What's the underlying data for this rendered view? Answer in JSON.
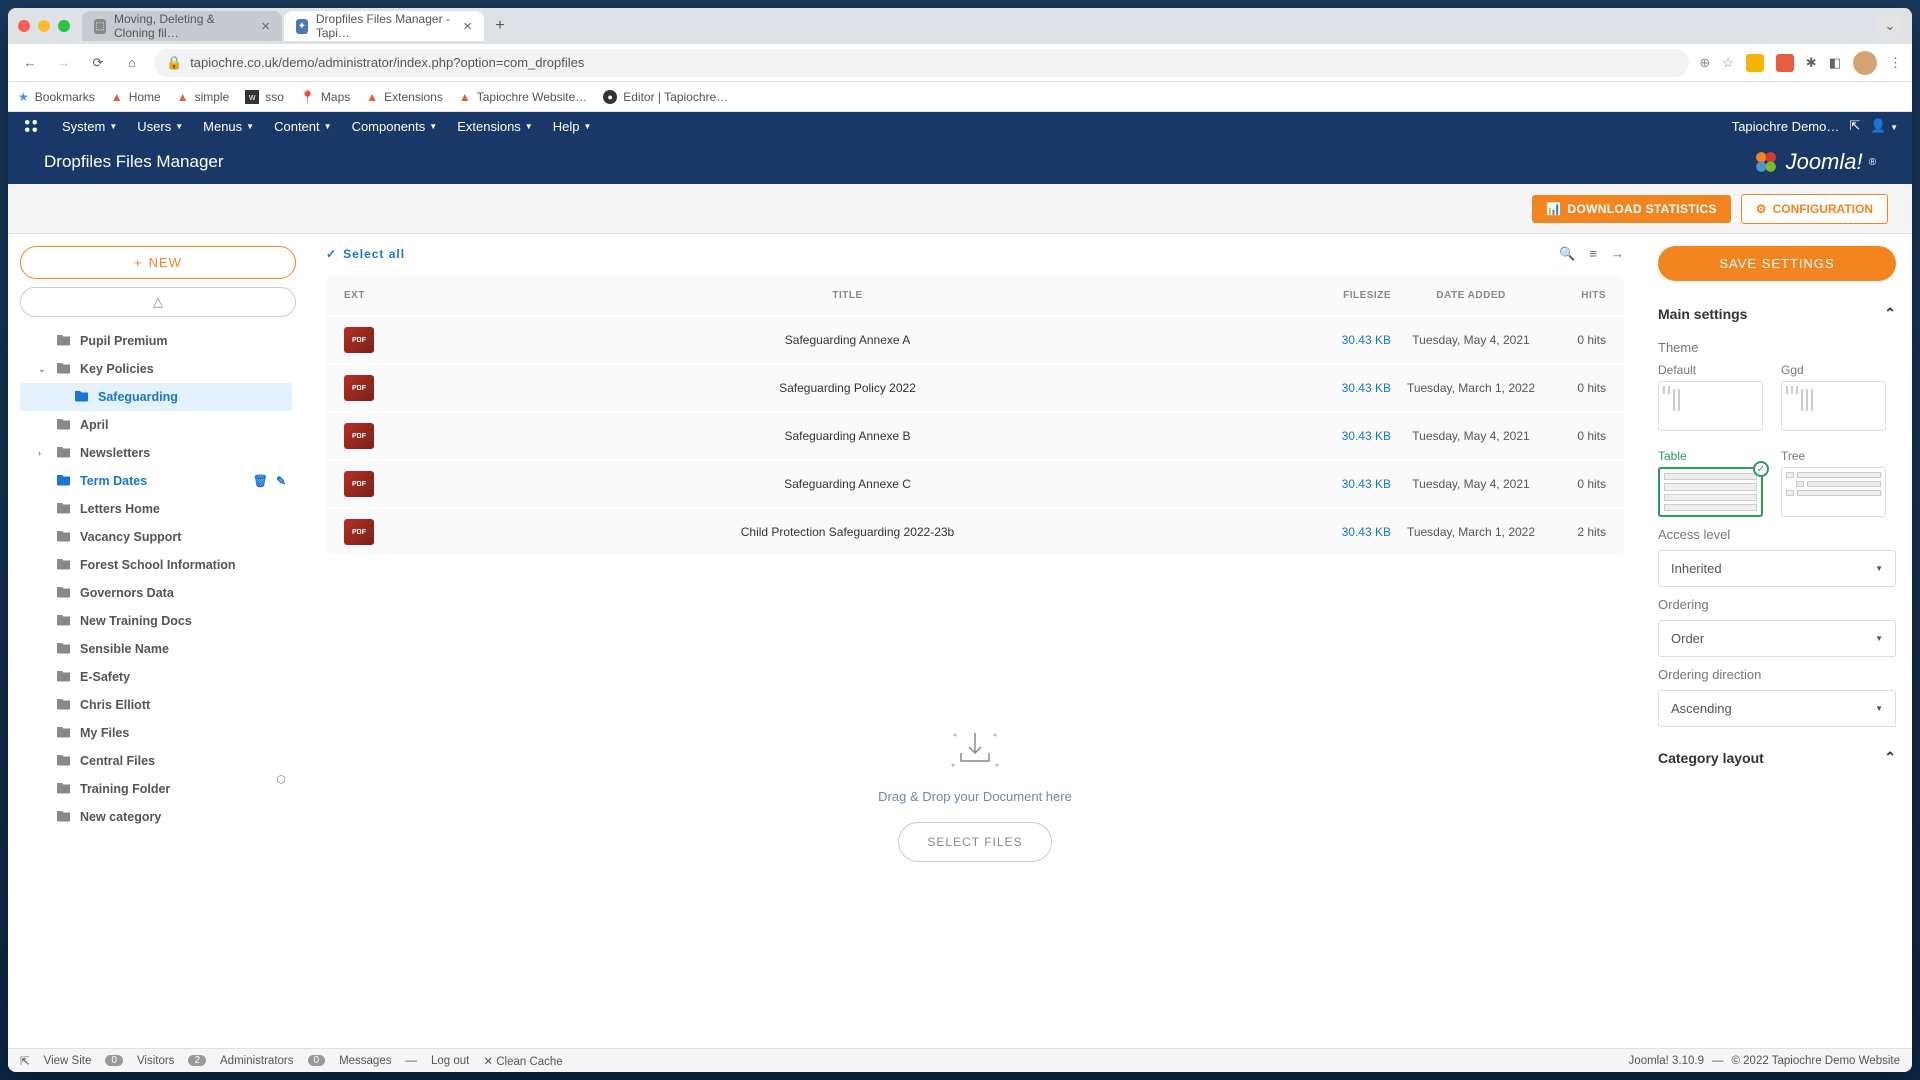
{
  "browser": {
    "tabs": [
      {
        "title": "Moving, Deleting & Cloning fil…",
        "active": false
      },
      {
        "title": "Dropfiles Files Manager - Tapi…",
        "active": true
      }
    ],
    "url_display": "tapiochre.co.uk/demo/administrator/index.php?option=com_dropfiles",
    "bookmarks": [
      "Bookmarks",
      "Home",
      "simple",
      "sso",
      "Maps",
      "Extensions",
      "Tapiochre Website…",
      "Editor | Tapiochre…"
    ]
  },
  "joomla": {
    "menu": [
      "System",
      "Users",
      "Menus",
      "Content",
      "Components",
      "Extensions",
      "Help"
    ],
    "site_name": "Tapiochre Demo…",
    "page_title": "Dropfiles Files Manager",
    "brand": "Joomla!"
  },
  "toolbar": {
    "download_stats": "DOWNLOAD STATISTICS",
    "configuration": "CONFIGURATION"
  },
  "sidebar": {
    "new": "NEW",
    "items": [
      {
        "label": "Pupil Premium",
        "level": 1
      },
      {
        "label": "Key Policies",
        "level": 1,
        "expanded": true
      },
      {
        "label": "Safeguarding",
        "level": 2,
        "active": true
      },
      {
        "label": "April",
        "level": 1
      },
      {
        "label": "Newsletters",
        "level": 1,
        "expandable": true
      },
      {
        "label": "Term Dates",
        "level": 1,
        "selected": true,
        "actions": true
      },
      {
        "label": "Letters Home",
        "level": 1
      },
      {
        "label": "Vacancy Support",
        "level": 1
      },
      {
        "label": "Forest School Information",
        "level": 1
      },
      {
        "label": "Governors Data",
        "level": 1
      },
      {
        "label": "New Training Docs",
        "level": 1
      },
      {
        "label": "Sensible Name",
        "level": 1
      },
      {
        "label": "E-Safety",
        "level": 1
      },
      {
        "label": "Chris Elliott",
        "level": 1
      },
      {
        "label": "My Files",
        "level": 1
      },
      {
        "label": "Central Files",
        "level": 1
      },
      {
        "label": "Training Folder",
        "level": 1
      },
      {
        "label": "New category",
        "level": 1
      }
    ]
  },
  "files": {
    "select_all": "Select all",
    "headers": {
      "ext": "EXT",
      "title": "TITLE",
      "size": "FILESIZE",
      "date": "DATE ADDED",
      "hits": "HITS"
    },
    "rows": [
      {
        "ext": "PDF",
        "title": "Safeguarding Annexe A",
        "size": "30.43 KB",
        "date": "Tuesday, May 4, 2021",
        "hits": "0 hits"
      },
      {
        "ext": "PDF",
        "title": "Safeguarding Policy 2022",
        "size": "30.43 KB",
        "date": "Tuesday, March 1, 2022",
        "hits": "0 hits"
      },
      {
        "ext": "PDF",
        "title": "Safeguarding Annexe B",
        "size": "30.43 KB",
        "date": "Tuesday, May 4, 2021",
        "hits": "0 hits"
      },
      {
        "ext": "PDF",
        "title": "Safeguarding Annexe C",
        "size": "30.43 KB",
        "date": "Tuesday, May 4, 2021",
        "hits": "0 hits"
      },
      {
        "ext": "PDF",
        "title": "Child Protection Safeguarding 2022-23b",
        "size": "30.43 KB",
        "date": "Tuesday, March 1, 2022",
        "hits": "2 hits"
      }
    ],
    "drop_hint": "Drag & Drop your Document here",
    "select_files": "SELECT FILES"
  },
  "settings": {
    "save": "SAVE SETTINGS",
    "main_settings": "Main settings",
    "theme_label": "Theme",
    "themes": [
      {
        "name": "Default"
      },
      {
        "name": "Ggd"
      },
      {
        "name": "Table",
        "selected": true
      },
      {
        "name": "Tree"
      }
    ],
    "access_level": {
      "label": "Access level",
      "value": "Inherited"
    },
    "ordering": {
      "label": "Ordering",
      "value": "Order"
    },
    "ordering_direction": {
      "label": "Ordering direction",
      "value": "Ascending"
    },
    "category_layout": "Category layout"
  },
  "status": {
    "view_site": "View Site",
    "visitors": {
      "count": "0",
      "label": "Visitors"
    },
    "admins": {
      "count": "2",
      "label": "Administrators"
    },
    "messages": {
      "count": "0",
      "label": "Messages"
    },
    "logout": "Log out",
    "clean_cache": "Clean Cache",
    "version": "Joomla! 3.10.9",
    "copyright": "© 2022 Tapiochre Demo Website"
  }
}
